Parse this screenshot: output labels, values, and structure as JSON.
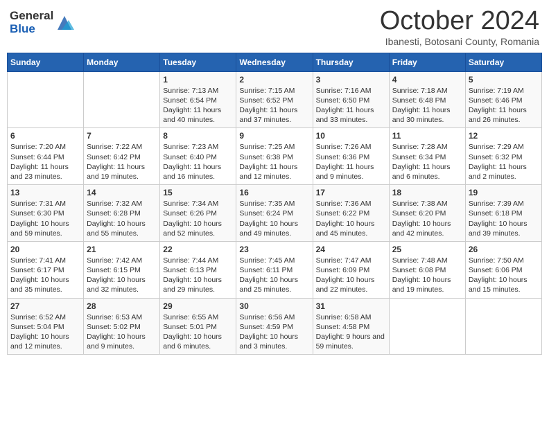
{
  "header": {
    "logo_general": "General",
    "logo_blue": "Blue",
    "month_title": "October 2024",
    "subtitle": "Ibanesti, Botosani County, Romania"
  },
  "days_of_week": [
    "Sunday",
    "Monday",
    "Tuesday",
    "Wednesday",
    "Thursday",
    "Friday",
    "Saturday"
  ],
  "weeks": [
    [
      {
        "day": "",
        "info": ""
      },
      {
        "day": "",
        "info": ""
      },
      {
        "day": "1",
        "info": "Sunrise: 7:13 AM\nSunset: 6:54 PM\nDaylight: 11 hours and 40 minutes."
      },
      {
        "day": "2",
        "info": "Sunrise: 7:15 AM\nSunset: 6:52 PM\nDaylight: 11 hours and 37 minutes."
      },
      {
        "day": "3",
        "info": "Sunrise: 7:16 AM\nSunset: 6:50 PM\nDaylight: 11 hours and 33 minutes."
      },
      {
        "day": "4",
        "info": "Sunrise: 7:18 AM\nSunset: 6:48 PM\nDaylight: 11 hours and 30 minutes."
      },
      {
        "day": "5",
        "info": "Sunrise: 7:19 AM\nSunset: 6:46 PM\nDaylight: 11 hours and 26 minutes."
      }
    ],
    [
      {
        "day": "6",
        "info": "Sunrise: 7:20 AM\nSunset: 6:44 PM\nDaylight: 11 hours and 23 minutes."
      },
      {
        "day": "7",
        "info": "Sunrise: 7:22 AM\nSunset: 6:42 PM\nDaylight: 11 hours and 19 minutes."
      },
      {
        "day": "8",
        "info": "Sunrise: 7:23 AM\nSunset: 6:40 PM\nDaylight: 11 hours and 16 minutes."
      },
      {
        "day": "9",
        "info": "Sunrise: 7:25 AM\nSunset: 6:38 PM\nDaylight: 11 hours and 12 minutes."
      },
      {
        "day": "10",
        "info": "Sunrise: 7:26 AM\nSunset: 6:36 PM\nDaylight: 11 hours and 9 minutes."
      },
      {
        "day": "11",
        "info": "Sunrise: 7:28 AM\nSunset: 6:34 PM\nDaylight: 11 hours and 6 minutes."
      },
      {
        "day": "12",
        "info": "Sunrise: 7:29 AM\nSunset: 6:32 PM\nDaylight: 11 hours and 2 minutes."
      }
    ],
    [
      {
        "day": "13",
        "info": "Sunrise: 7:31 AM\nSunset: 6:30 PM\nDaylight: 10 hours and 59 minutes."
      },
      {
        "day": "14",
        "info": "Sunrise: 7:32 AM\nSunset: 6:28 PM\nDaylight: 10 hours and 55 minutes."
      },
      {
        "day": "15",
        "info": "Sunrise: 7:34 AM\nSunset: 6:26 PM\nDaylight: 10 hours and 52 minutes."
      },
      {
        "day": "16",
        "info": "Sunrise: 7:35 AM\nSunset: 6:24 PM\nDaylight: 10 hours and 49 minutes."
      },
      {
        "day": "17",
        "info": "Sunrise: 7:36 AM\nSunset: 6:22 PM\nDaylight: 10 hours and 45 minutes."
      },
      {
        "day": "18",
        "info": "Sunrise: 7:38 AM\nSunset: 6:20 PM\nDaylight: 10 hours and 42 minutes."
      },
      {
        "day": "19",
        "info": "Sunrise: 7:39 AM\nSunset: 6:18 PM\nDaylight: 10 hours and 39 minutes."
      }
    ],
    [
      {
        "day": "20",
        "info": "Sunrise: 7:41 AM\nSunset: 6:17 PM\nDaylight: 10 hours and 35 minutes."
      },
      {
        "day": "21",
        "info": "Sunrise: 7:42 AM\nSunset: 6:15 PM\nDaylight: 10 hours and 32 minutes."
      },
      {
        "day": "22",
        "info": "Sunrise: 7:44 AM\nSunset: 6:13 PM\nDaylight: 10 hours and 29 minutes."
      },
      {
        "day": "23",
        "info": "Sunrise: 7:45 AM\nSunset: 6:11 PM\nDaylight: 10 hours and 25 minutes."
      },
      {
        "day": "24",
        "info": "Sunrise: 7:47 AM\nSunset: 6:09 PM\nDaylight: 10 hours and 22 minutes."
      },
      {
        "day": "25",
        "info": "Sunrise: 7:48 AM\nSunset: 6:08 PM\nDaylight: 10 hours and 19 minutes."
      },
      {
        "day": "26",
        "info": "Sunrise: 7:50 AM\nSunset: 6:06 PM\nDaylight: 10 hours and 15 minutes."
      }
    ],
    [
      {
        "day": "27",
        "info": "Sunrise: 6:52 AM\nSunset: 5:04 PM\nDaylight: 10 hours and 12 minutes."
      },
      {
        "day": "28",
        "info": "Sunrise: 6:53 AM\nSunset: 5:02 PM\nDaylight: 10 hours and 9 minutes."
      },
      {
        "day": "29",
        "info": "Sunrise: 6:55 AM\nSunset: 5:01 PM\nDaylight: 10 hours and 6 minutes."
      },
      {
        "day": "30",
        "info": "Sunrise: 6:56 AM\nSunset: 4:59 PM\nDaylight: 10 hours and 3 minutes."
      },
      {
        "day": "31",
        "info": "Sunrise: 6:58 AM\nSunset: 4:58 PM\nDaylight: 9 hours and 59 minutes."
      },
      {
        "day": "",
        "info": ""
      },
      {
        "day": "",
        "info": ""
      }
    ]
  ]
}
